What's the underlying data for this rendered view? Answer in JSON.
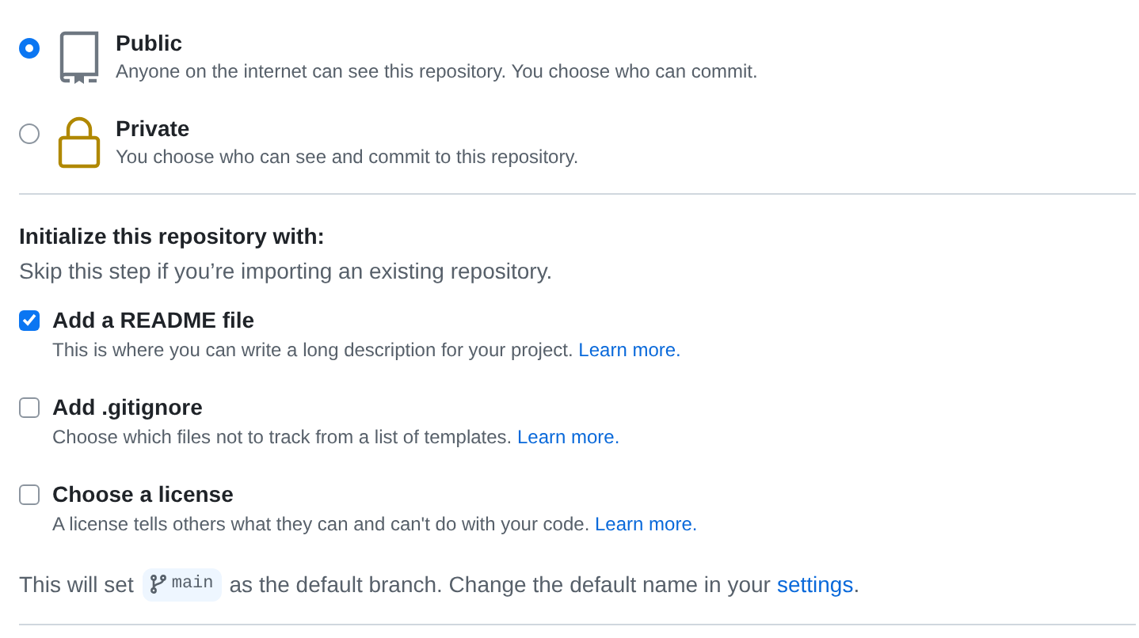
{
  "visibility": [
    {
      "kind": "public",
      "selected": true,
      "title": "Public",
      "description": "Anyone on the internet can see this repository. You choose who can commit."
    },
    {
      "kind": "private",
      "selected": false,
      "title": "Private",
      "description": "You choose who can see and commit to this repository."
    }
  ],
  "initialize": {
    "heading": "Initialize this repository with:",
    "subheading": "Skip this step if you’re importing an existing repository.",
    "options": [
      {
        "checked": true,
        "title": "Add a README file",
        "description": "This is where you can write a long description for your project.",
        "link": "Learn more."
      },
      {
        "checked": false,
        "title": "Add .gitignore",
        "description": "Choose which files not to track from a list of templates.",
        "link": "Learn more."
      },
      {
        "checked": false,
        "title": "Choose a license",
        "description": "A license tells others what they can and can't do with your code.",
        "link": "Learn more."
      }
    ]
  },
  "default_branch": {
    "before": "This will set",
    "branch": "main",
    "after": "as the default branch. Change the default name in your",
    "link": "settings",
    "end": "."
  }
}
